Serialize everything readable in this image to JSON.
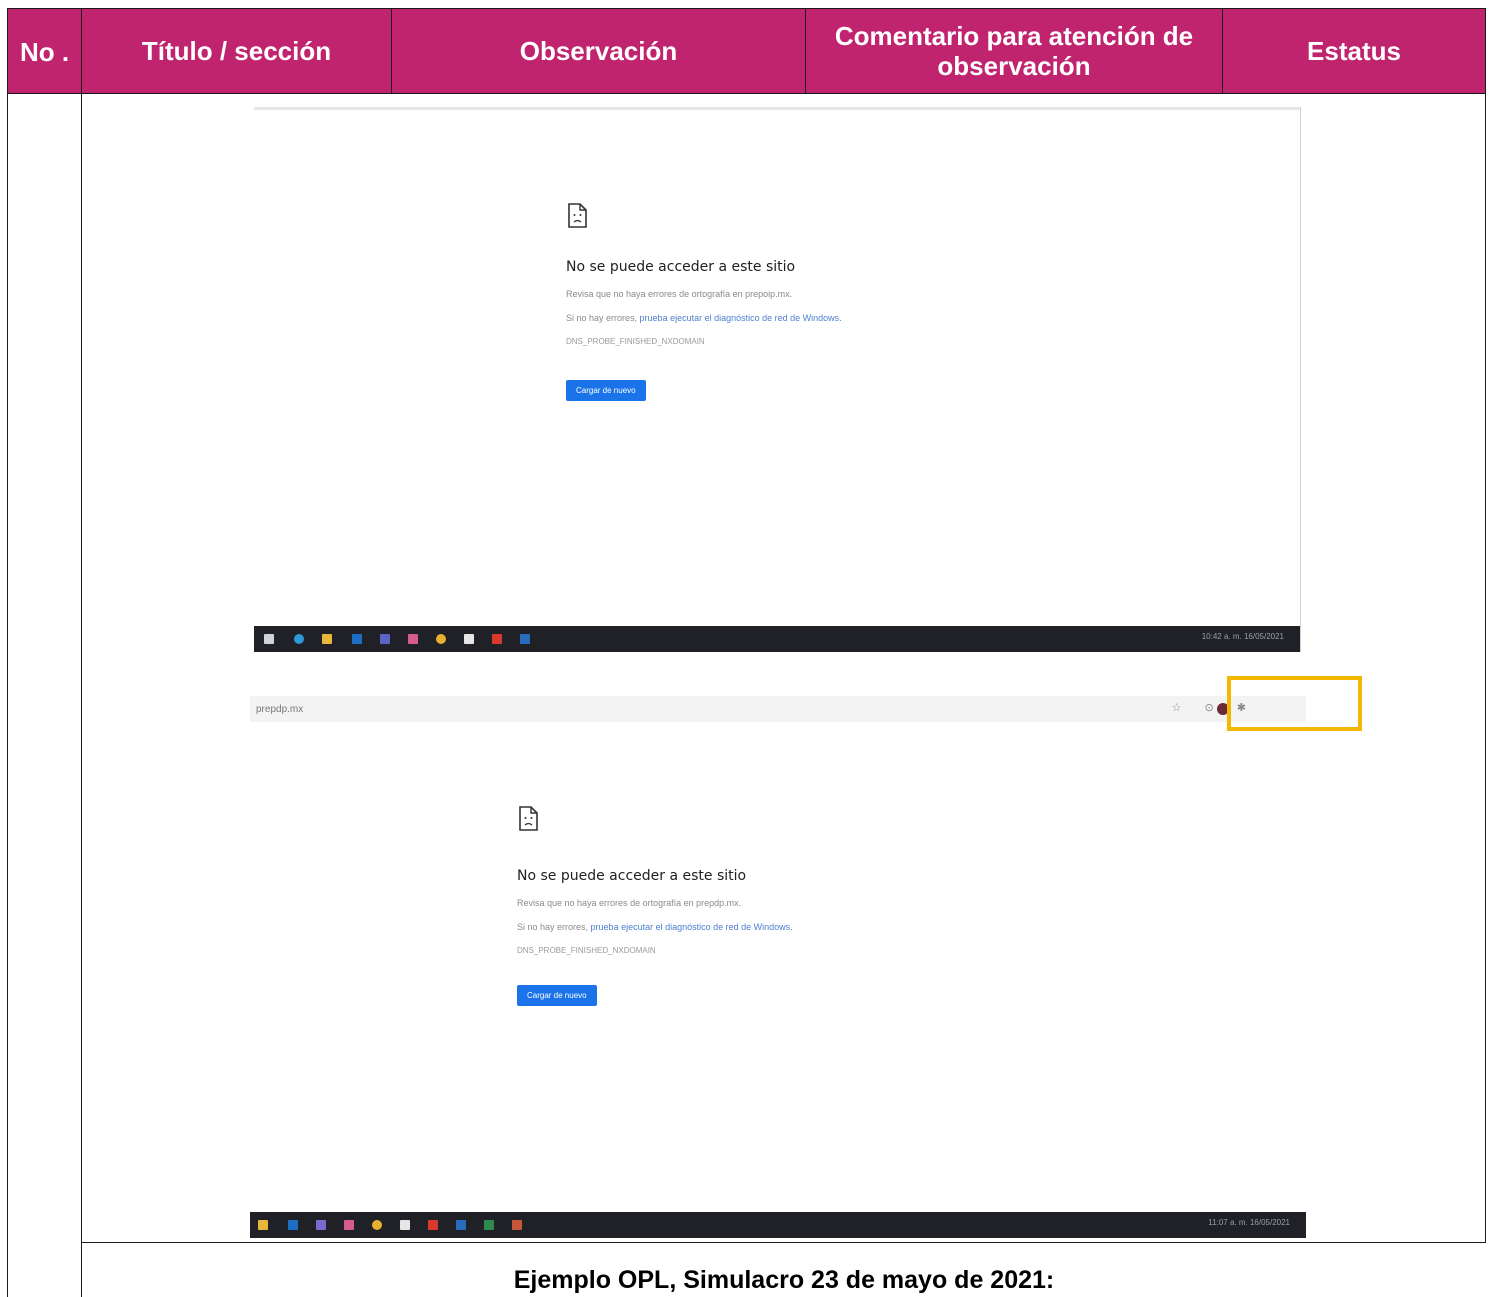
{
  "table": {
    "headers": {
      "no": "No .",
      "title": "Título / sección",
      "observation": "Observación",
      "comment": "Comentario para atención de observación",
      "status": "Estatus"
    },
    "header_color": "#c0246f"
  },
  "screenshot_1": {
    "error_title": "No se puede acceder a este sitio",
    "line1": "Revisa que no haya errores de ortografía en prepoip.mx.",
    "line2_prefix": "Si no hay errores, ",
    "line2_link": "prueba ejecutar el diagnóstico de red de Windows.",
    "error_code": "DNS_PROBE_FINISHED_NXDOMAIN",
    "reload_button": "Cargar de nuevo",
    "clock": "10:42 a. m. 16/05/2021"
  },
  "screenshot_2": {
    "url": "prepdp.mx",
    "error_title": "No se puede acceder a este sitio",
    "line1": "Revisa que no haya errores de ortografía en prepdp.mx.",
    "line2_prefix": "Si no hay errores, ",
    "line2_link": "prueba ejecutar el diagnóstico de red de Windows.",
    "error_code": "DNS_PROBE_FINISHED_NXDOMAIN",
    "reload_button": "Cargar de nuevo",
    "clock": "11:07 a. m. 16/05/2021"
  },
  "highlight_color": "#f5b800",
  "caption": "Ejemplo OPL, Simulacro 23 de mayo de 2021:"
}
